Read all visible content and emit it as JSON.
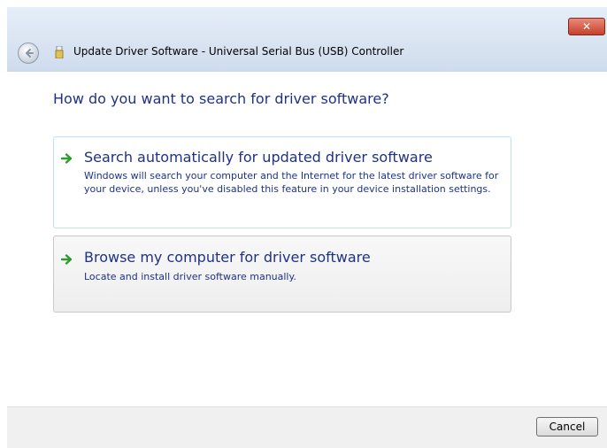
{
  "window": {
    "title": "Update Driver Software - Universal Serial Bus (USB) Controller",
    "close_label": "✕"
  },
  "main": {
    "heading": "How do you want to search for driver software?",
    "options": [
      {
        "title": "Search automatically for updated driver software",
        "description": "Windows will search your computer and the Internet for the latest driver software for your device, unless you've disabled this feature in your device installation settings."
      },
      {
        "title": "Browse my computer for driver software",
        "description": "Locate and install driver software manually."
      }
    ]
  },
  "footer": {
    "cancel_label": "Cancel"
  },
  "colors": {
    "accent_text": "#1e3287",
    "arrow_green": "#2e9b2e"
  },
  "icons": [
    "close-icon",
    "back-arrow-icon",
    "usb-device-icon",
    "green-arrow-icon"
  ]
}
